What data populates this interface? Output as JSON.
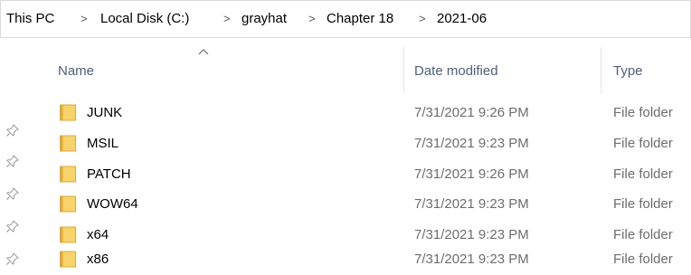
{
  "breadcrumb": {
    "items": [
      {
        "label": "This PC"
      },
      {
        "label": "Local Disk (C:)"
      },
      {
        "label": "grayhat"
      },
      {
        "label": "Chapter 18"
      },
      {
        "label": "2021-06"
      }
    ],
    "separator": ">"
  },
  "columns": {
    "name": "Name",
    "date_modified": "Date modified",
    "type": "Type",
    "sort_direction": "ascending"
  },
  "files": [
    {
      "name": "JUNK",
      "date": "7/31/2021 9:26 PM",
      "type": "File folder",
      "icon": "folder-icon"
    },
    {
      "name": "MSIL",
      "date": "7/31/2021 9:23 PM",
      "type": "File folder",
      "icon": "folder-icon"
    },
    {
      "name": "PATCH",
      "date": "7/31/2021 9:26 PM",
      "type": "File folder",
      "icon": "folder-icon"
    },
    {
      "name": "WOW64",
      "date": "7/31/2021 9:23 PM",
      "type": "File folder",
      "icon": "folder-icon"
    },
    {
      "name": "x64",
      "date": "7/31/2021 9:23 PM",
      "type": "File folder",
      "icon": "folder-icon"
    },
    {
      "name": "x86",
      "date": "7/31/2021 9:23 PM",
      "type": "File folder",
      "icon": "folder-icon"
    }
  ],
  "quick_access_pins": 5,
  "colors": {
    "folder": "#f7d36b",
    "folder_dark": "#e0a93a",
    "header_text": "#4c607a",
    "secondary_text": "#6d6d6d"
  }
}
